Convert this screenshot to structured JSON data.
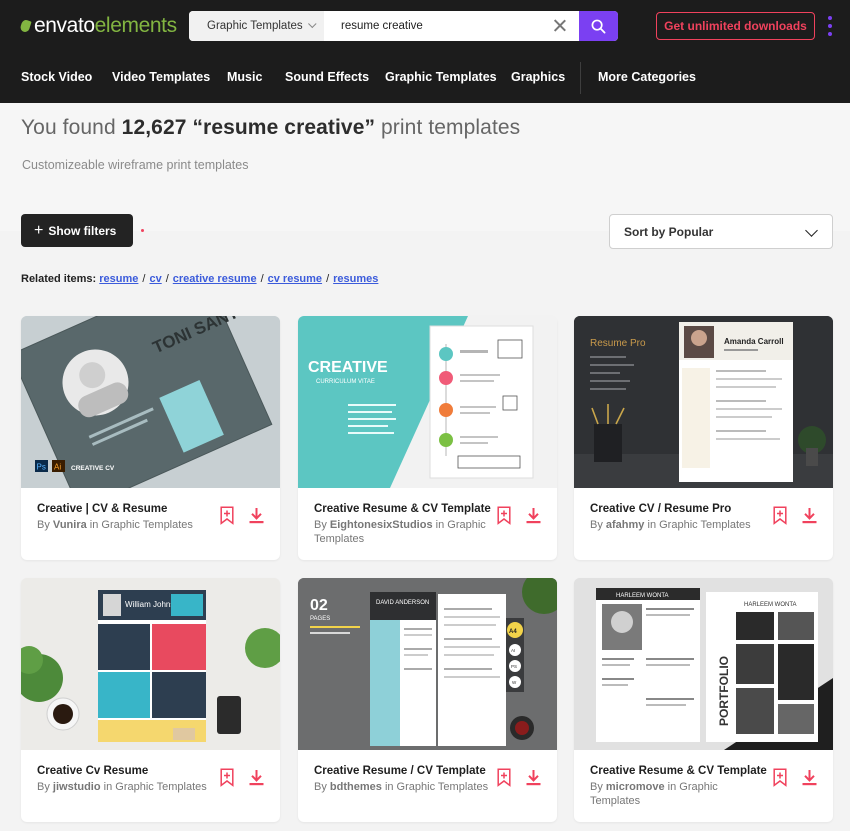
{
  "brand": {
    "part1": "envato",
    "part2": "elements"
  },
  "search": {
    "category": "Graphic Templates",
    "query": "resume creative"
  },
  "header": {
    "cta": "Get unlimited downloads"
  },
  "nav": [
    "Stock Video",
    "Video Templates",
    "Music",
    "Sound Effects",
    "Graphic Templates",
    "Graphics",
    "More Categories"
  ],
  "results": {
    "prefix": "You found",
    "count": "12,627",
    "query": "“resume creative”",
    "suffix": "print templates",
    "subtitle": "Customizeable wireframe print templates"
  },
  "controls": {
    "filters": "Show filters",
    "sort": "Sort by Popular"
  },
  "related": {
    "label": "Related items:",
    "items": [
      "resume",
      "cv",
      "creative resume",
      "cv resume",
      "resumes"
    ]
  },
  "cards": [
    {
      "title": "Creative | CV & Resume",
      "author_prefix": "By",
      "author": "Vunira",
      "category": "in Graphic Templates",
      "thumb": {
        "name_text": "TONI SANTUY",
        "badge_ps": "Ps",
        "badge_ai": "Ai",
        "badge_label": "CREATIVE CV"
      }
    },
    {
      "title": "Creative Resume & CV Template",
      "author_prefix": "By",
      "author": "EightonesixStudios",
      "category": "in Graphic Templates",
      "thumb": {
        "big_text": "CREATIVE",
        "small_text": "CURRICULUM VITAE"
      }
    },
    {
      "title": "Creative CV / Resume Pro",
      "author_prefix": "By",
      "author": "afahmy",
      "category": "in Graphic Templates",
      "thumb": {
        "title_text": "Resume Pro",
        "name_text": "Amanda Carroll"
      }
    },
    {
      "title": "Creative Cv Resume",
      "author_prefix": "By",
      "author": "jiwstudio",
      "category": "in Graphic Templates",
      "thumb": {
        "name_text": "William Johnson"
      }
    },
    {
      "title": "Creative Resume / CV Template",
      "author_prefix": "By",
      "author": "bdthemes",
      "category": "in Graphic Templates",
      "thumb": {
        "pages": "02",
        "pages_label": "PAGES",
        "name_text": "DAVID ANDERSON",
        "format": "A4",
        "apps": [
          "AI",
          "PS",
          "W"
        ]
      }
    },
    {
      "title": "Creative Resume & CV Template",
      "author_prefix": "By",
      "author": "micromove",
      "category": "in Graphic Templates",
      "thumb": {
        "name_text": "HARLEEM WONTA",
        "portfolio": "PORTFOLIO"
      }
    }
  ],
  "colors": {
    "accent": "#7b40f2",
    "brand_green": "#82b541",
    "cta": "#f0425d",
    "header_bg": "#1c1c1c"
  }
}
